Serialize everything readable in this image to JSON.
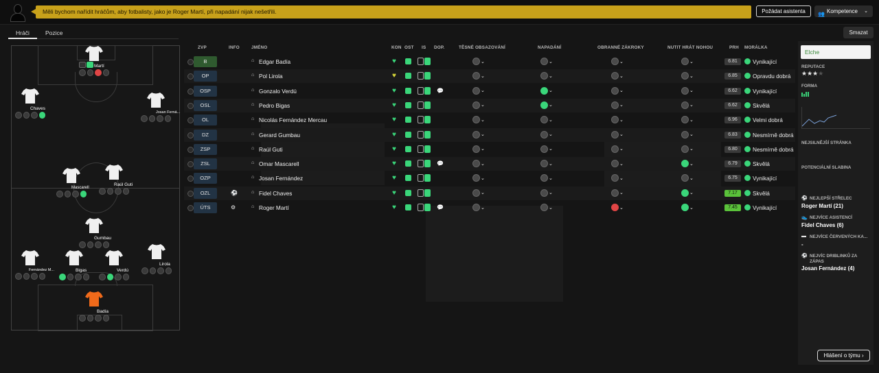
{
  "banner": {
    "text": "Měli bychom nařídit hráčům, aby fotbalisty, jako je Roger Martí, při napadání nijak nešetřili."
  },
  "header": {
    "assistant_button": "Požádat asistenta",
    "competence_button": "Kompetence"
  },
  "tabs": [
    {
      "label": "Hráči",
      "active": true
    },
    {
      "label": "Pozice",
      "active": false
    }
  ],
  "clear_button": "Smazat",
  "pitch_players": [
    {
      "name": "Martí"
    },
    {
      "name": "Chaves"
    },
    {
      "name": "Josan Ferná..."
    },
    {
      "name": "Mascarell"
    },
    {
      "name": "Raúl Guti"
    },
    {
      "name": "Gumbau"
    },
    {
      "name": "Fernández M..."
    },
    {
      "name": "Bigas"
    },
    {
      "name": "Verdú"
    },
    {
      "name": "Lirola"
    },
    {
      "name": "Badía"
    }
  ],
  "table": {
    "headers": {
      "zvp": "ZVP",
      "info": "INFO",
      "name": "JMÉNO",
      "kon": "KON",
      "ost": "OST",
      "is": "IS",
      "dop": "DOP.",
      "marking": "TĚSNÉ OBSAZOVÁNÍ",
      "pressing": "NAPADÁNÍ",
      "tackling": "OBRANNÉ ZÁKROKY",
      "weakfoot": "NUTIT HRÁT NOHOU",
      "prh": "PRH",
      "morale": "MORÁLKA"
    },
    "rows": [
      {
        "pos": "B",
        "name": "Edgar Badía",
        "rating": "6.81",
        "morale": "Vynikající"
      },
      {
        "pos": "OP",
        "name": "Pol Lirola",
        "rating": "6.85",
        "morale": "Opravdu dobrá"
      },
      {
        "pos": "OSP",
        "name": "Gonzalo Verdú",
        "rating": "6.62",
        "morale": "Vynikající"
      },
      {
        "pos": "OSL",
        "name": "Pedro Bigas",
        "rating": "6.62",
        "morale": "Skvělá"
      },
      {
        "pos": "OL",
        "name": "Nicolás Fernández Mercau",
        "rating": "6.96",
        "morale": "Velmi dobrá"
      },
      {
        "pos": "DZ",
        "name": "Gerard Gumbau",
        "rating": "6.83",
        "morale": "Nesmírně dobrá"
      },
      {
        "pos": "ZSP",
        "name": "Raúl Guti",
        "rating": "6.80",
        "morale": "Nesmírně dobrá"
      },
      {
        "pos": "ZSL",
        "name": "Omar Mascarell",
        "rating": "6.79",
        "morale": "Skvělá"
      },
      {
        "pos": "OZP",
        "name": "Josan Fernández",
        "rating": "6.75",
        "morale": "Vynikající"
      },
      {
        "pos": "OZL",
        "name": "Fidel Chaves",
        "rating": "7.17",
        "morale": "Skvělá"
      },
      {
        "pos": "ÚTS",
        "name": "Roger Martí",
        "rating": "7.45",
        "morale": "Vynikající"
      }
    ]
  },
  "side_panel": {
    "team": "Elche",
    "reputation_label": "REPUTACE",
    "reputation_stars": "★★★",
    "form_label": "FORMA",
    "strongest_label": "NEJSILNĚJŠÍ STRÁNKA",
    "weakness_label": "POTENCIÁLNÍ SLABINA",
    "top_scorer_label": "NEJLEPŠÍ STŘELEC",
    "top_scorer_value": "Roger Martí (21)",
    "top_assists_label": "NEJVÍCE ASISTENCÍ",
    "top_assists_value": "Fidel Chaves (6)",
    "red_cards_label": "NEJVÍCE ČERVENÝCH KA...",
    "red_cards_value": "-",
    "dribbles_label_1": "NEJVÍC DRIBLINKŮ ZA",
    "dribbles_label_2": "ZÁPAS",
    "dribbles_value": "Josan Fernández (4)",
    "report_button": "Hlášení o týmu"
  },
  "colors": {
    "accent": "#3ad67a",
    "banner": "#c8a11a",
    "danger": "#e04545"
  }
}
